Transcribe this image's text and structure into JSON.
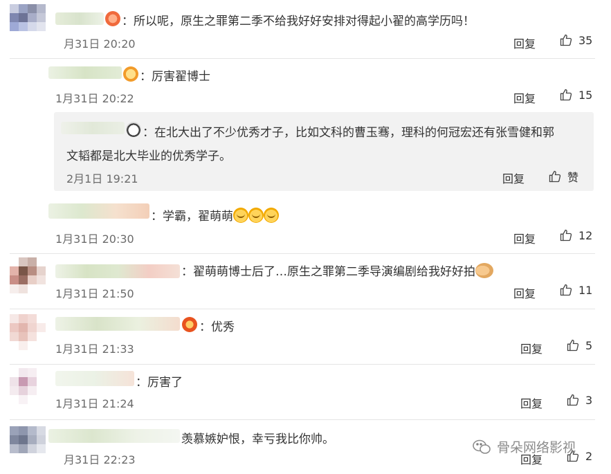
{
  "comments": [
    {
      "text": "：所以呢，原生之罪第二季不给我好好安排对得起小翟的高学历吗！",
      "time": "月31日 20:20",
      "reply": "回复",
      "likes": "35"
    },
    {
      "text": "：厉害翟博士",
      "time": "1月31日 20:22",
      "reply": "回复",
      "likes": "15"
    },
    {
      "text_line1": "：在北大出了不少优秀才子，比如文科的曹玉骞，理科的何冠宏还有张雪健和郭",
      "text_line2": "文韬都是北大毕业的优秀学子。",
      "time": "2月1日 19:21",
      "reply": "回复",
      "likes": "赞"
    },
    {
      "text": "：学霸，翟萌萌",
      "time": "1月31日 20:30",
      "reply": "回复",
      "likes": "12"
    },
    {
      "text": "：翟萌萌博士后了…原生之罪第二季导演编剧给我好好拍",
      "time": "1月31日 21:50",
      "reply": "回复",
      "likes": "11"
    },
    {
      "text": "：优秀",
      "time": "1月31日 21:33",
      "reply": "回复",
      "likes": "5"
    },
    {
      "text": "：厉害了",
      "time": "1月31日 21:24",
      "reply": "回复",
      "likes": "3"
    },
    {
      "text": "羡慕嫉妒恨，幸亏我比你帅。",
      "time": "月31日 22:23",
      "reply": "回复",
      "likes": "2"
    }
  ],
  "watermark": "骨朵网络影视",
  "icons": {
    "like": "thumbs-up-icon",
    "watermark": "wechat-icon"
  },
  "colors": {
    "text": "#333333",
    "meta": "#6b6b6b",
    "quote_bg": "#f2f2f2"
  }
}
